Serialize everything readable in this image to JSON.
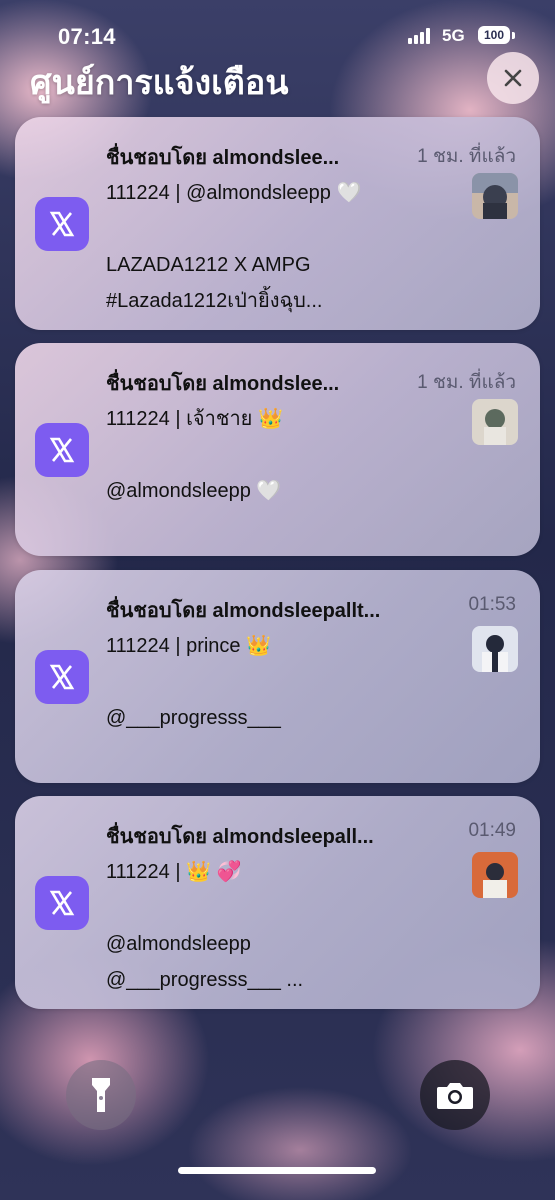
{
  "status_bar": {
    "time": "07:14",
    "network": "5G",
    "battery": "100"
  },
  "notification_center": {
    "title": "ศูนย์การแจ้งเตือน",
    "close_icon": "close-icon"
  },
  "notifications": [
    {
      "app_icon": "x-logo-icon",
      "sender": "ชื่นชอบโดย almondslee...",
      "stamp": "1 ชม. ที่แล้ว",
      "body": "111224 | @almondsleepp 🤍\n\nLAZADA1212 X AMPG\n#Lazada1212เป่ายิ้งฉุบ...",
      "thumbnail_colors": [
        "#3a3f4f",
        "#c9b7a8"
      ]
    },
    {
      "app_icon": "x-logo-icon",
      "sender": "ชื่นชอบโดย almondslee...",
      "stamp": "1 ชม. ที่แล้ว",
      "body": "111224 | เจ้าชาย 👑\n\n@almondsleepp 🤍",
      "thumbnail_colors": [
        "#5c6a5e",
        "#dcd6cc"
      ]
    },
    {
      "app_icon": "x-logo-icon",
      "sender": "ชื่นชอบโดย almondsleepallt...",
      "stamp": "01:53",
      "body": "111224 | prince 👑\n\n@___progresss___",
      "thumbnail_colors": [
        "#24293a",
        "#e0e4ee"
      ]
    },
    {
      "app_icon": "x-logo-icon",
      "sender": "ชื่นชอบโดย almondsleepall...",
      "stamp": "01:49",
      "body": "111224 | 👑 💞\n\n@almondsleepp\n@___progresss___ ...",
      "thumbnail_colors": [
        "#d86a3a",
        "#2b2d3a"
      ]
    }
  ],
  "controls": {
    "flashlight_icon": "flashlight-icon",
    "camera_icon": "camera-icon"
  }
}
